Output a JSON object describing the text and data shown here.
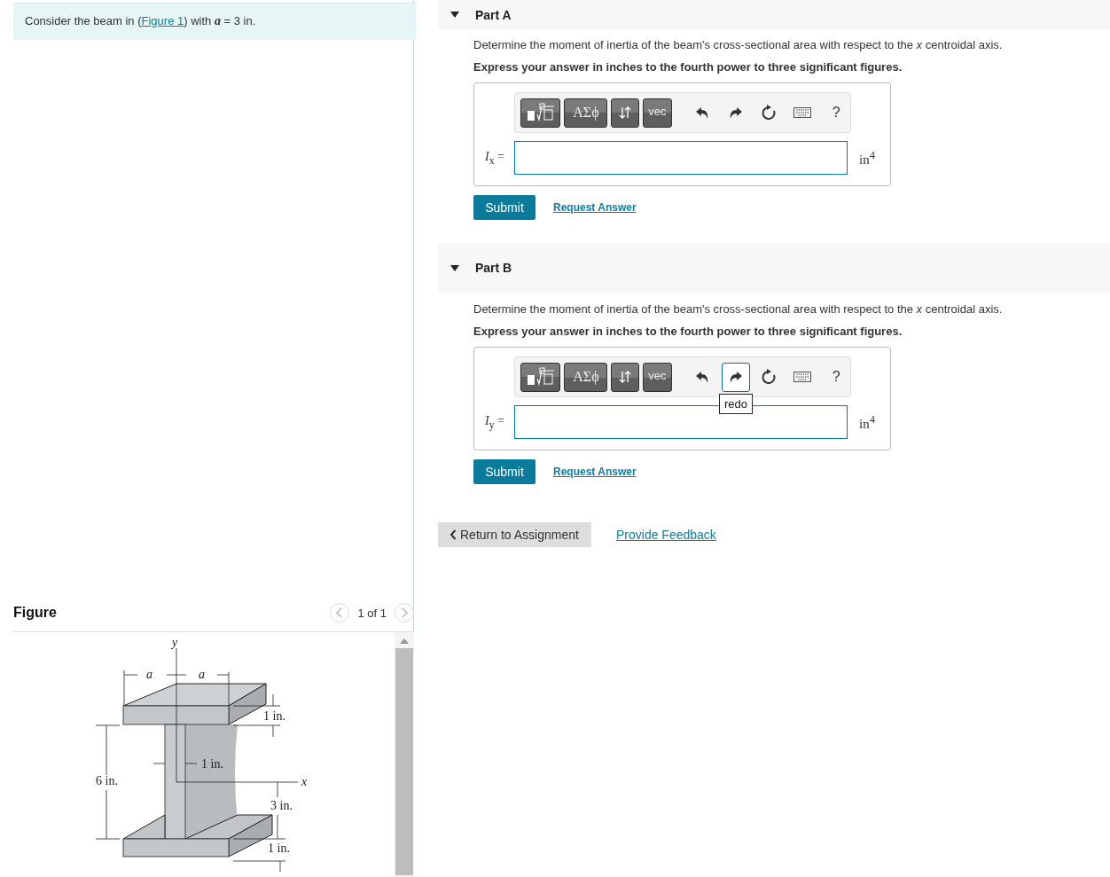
{
  "intro": {
    "text_before": "Consider the beam in (",
    "link": "Figure 1",
    "text_after": ") with *a* = 3 in."
  },
  "figure": {
    "title": "Figure",
    "pager": "1 of 1",
    "labels": [
      {
        "kind": "axis",
        "text": "y"
      },
      {
        "kind": "symbol",
        "text": "a"
      },
      {
        "kind": "symbol",
        "text": "a"
      },
      {
        "kind": "dimension",
        "text": "1 in."
      },
      {
        "kind": "dimension",
        "text": "1 in."
      },
      {
        "kind": "dimension",
        "text": "6 in."
      },
      {
        "kind": "axis",
        "text": "x"
      },
      {
        "kind": "dimension",
        "text": "3 in."
      },
      {
        "kind": "dimension",
        "text": "1 in."
      }
    ]
  },
  "parts": [
    {
      "title": "Part A",
      "expanded": true,
      "question": "Determine the moment of inertia of the beam's cross-sectional area with respect to the *x* centroidal axis.",
      "instruction": "Express your answer in inches to the fourth power to three significant figures.",
      "tools": [
        {
          "kind": "templates",
          "hovered": false
        },
        {
          "kind": "greek",
          "label": "ΑΣϕ",
          "hovered": false
        },
        {
          "kind": "arrows",
          "hovered": false
        },
        {
          "kind": "vec",
          "label": "vec",
          "hovered": false
        },
        {
          "kind": "undo",
          "hovered": false
        },
        {
          "kind": "redo",
          "hovered": false
        },
        {
          "kind": "reset",
          "hovered": false
        },
        {
          "kind": "keyboard",
          "hovered": false
        },
        {
          "kind": "help",
          "label": "?",
          "hovered": false
        }
      ],
      "variable": "*I*$_{x}$ =",
      "unit": "in$^{4}$",
      "submit": "Submit",
      "request": "Request Answer"
    },
    {
      "title": "Part B",
      "expanded": true,
      "question": "Determine the moment of inertia of the beam's cross-sectional area with respect to the *x* centroidal axis.",
      "instruction": "Express your answer in inches to the fourth power to three significant figures.",
      "tools": [
        {
          "kind": "templates",
          "hovered": false
        },
        {
          "kind": "greek",
          "label": "ΑΣϕ",
          "hovered": false
        },
        {
          "kind": "arrows",
          "hovered": false
        },
        {
          "kind": "vec",
          "label": "vec",
          "hovered": false
        },
        {
          "kind": "undo",
          "hovered": false
        },
        {
          "kind": "redo",
          "hovered": true,
          "tooltip": "redo"
        },
        {
          "kind": "reset",
          "hovered": false
        },
        {
          "kind": "keyboard",
          "hovered": false
        },
        {
          "kind": "help",
          "label": "?",
          "hovered": false
        }
      ],
      "variable": "*I*$_{y}$ =",
      "unit": "in$^{4}$",
      "submit": "Submit",
      "request": "Request Answer"
    }
  ],
  "footer": {
    "return": "Return to Assignment",
    "feedback": "Provide Feedback"
  }
}
